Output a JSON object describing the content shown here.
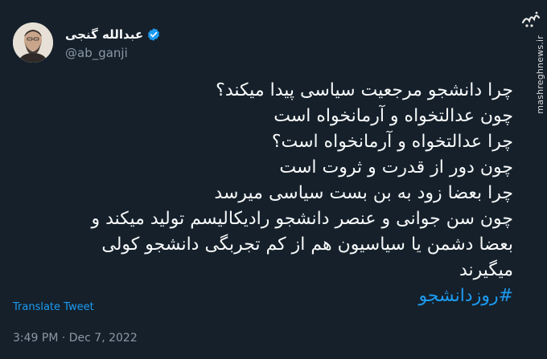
{
  "author": {
    "name": "عبدالله گنجی",
    "handle": "@ab_ganji",
    "verified_icon": "verified-badge-icon",
    "badge_color": "#1d9bf0"
  },
  "tweet": {
    "lines": [
      "چرا دانشجو مرجعیت سیاسی پیدا میکند؟",
      "چون عدالتخواه و آرمانخواه است",
      "چرا عدالتخواه و آرمانخواه است؟",
      "چون دور از قدرت و ثروت است",
      "چرا بعضا زود به بن بست سیاسی میرسد",
      "چون سن جوانی و عنصر دانشجو رادیکالیسم تولید میکند و",
      "بعضا دشمن یا سیاسیون هم از کم تجربگی دانشجو کولی",
      "میگیرند"
    ],
    "hashtag": "#روزدانشجو"
  },
  "translate_label": "Translate Tweet",
  "timestamp": "3:49 PM · Dec 7, 2022",
  "watermark": {
    "text": "mashreghnews.ir"
  },
  "colors": {
    "background": "#15202b",
    "text": "#f7f9f9",
    "muted": "#8b98a5",
    "link": "#1d9bf0"
  }
}
